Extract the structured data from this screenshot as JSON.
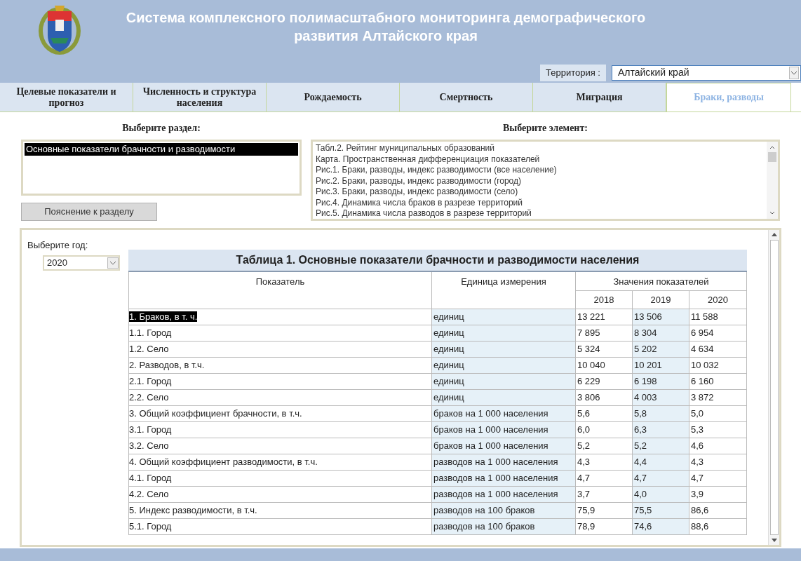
{
  "header": {
    "title": "Система комплексного полимасштабного мониторинга демографического развития Алтайского края",
    "territory": {
      "label": "Территория :",
      "value": "Алтайский край"
    }
  },
  "tabs": [
    {
      "label": "Целевые показатели и прогноз",
      "selected": false
    },
    {
      "label": "Численность и структура населения",
      "selected": false
    },
    {
      "label": "Рождаемость",
      "selected": false
    },
    {
      "label": "Смертность",
      "selected": false
    },
    {
      "label": "Миграция",
      "selected": false
    },
    {
      "label": "Браки, разводы",
      "selected": true
    }
  ],
  "sections": {
    "heading": "Выберите раздел:",
    "items": [
      {
        "label": "Основные показатели брачности и разводимости",
        "selected": true
      }
    ],
    "button": "Пояснение к разделу"
  },
  "elements": {
    "heading": "Выберите элемент:",
    "items": [
      {
        "label": "Табл.2. Рейтинг муниципальных образований",
        "selected": false
      },
      {
        "label": "Карта. Пространственная дифференциация показателей",
        "selected": false
      },
      {
        "label": "Рис.1. Браки, разводы, индекс разводимости (все население)",
        "selected": false
      },
      {
        "label": "Рис.2. Браки, разводы, индекс разводимости (город)",
        "selected": false
      },
      {
        "label": "Рис.3. Браки, разводы, индекс разводимости (село)",
        "selected": false
      },
      {
        "label": "Рис.4. Динамика числа браков в разрезе территорий",
        "selected": false
      },
      {
        "label": "Рис.5. Динамика числа разводов в разрезе территорий",
        "selected": false
      }
    ]
  },
  "year": {
    "label": "Выберите год:",
    "value": "2020"
  },
  "table": {
    "title": "Таблица 1. Основные показатели брачности и разводимости населения",
    "columns": {
      "indicator": "Показатель",
      "unit": "Единица измерения",
      "values": "Значения показателей",
      "years": [
        "2018",
        "2019",
        "2020"
      ]
    },
    "rows": [
      {
        "indicator": "1. Браков, в т. ч.",
        "unit": "единиц",
        "values": [
          "13 221",
          "13 506",
          "11 588"
        ],
        "selected": true
      },
      {
        "indicator": "1.1. Город",
        "unit": "единиц",
        "values": [
          "7 895",
          "8 304",
          "6 954"
        ],
        "selected": false
      },
      {
        "indicator": "1.2. Село",
        "unit": "единиц",
        "values": [
          "5 324",
          "5 202",
          "4 634"
        ],
        "selected": false
      },
      {
        "indicator": "2. Разводов, в т.ч.",
        "unit": "единиц",
        "values": [
          "10 040",
          "10 201",
          "10 032"
        ],
        "selected": false
      },
      {
        "indicator": "2.1. Город",
        "unit": "единиц",
        "values": [
          "6 229",
          "6 198",
          "6 160"
        ],
        "selected": false
      },
      {
        "indicator": "2.2. Село",
        "unit": "единиц",
        "values": [
          "3 806",
          "4 003",
          "3 872"
        ],
        "selected": false
      },
      {
        "indicator": "3. Общий коэффициент брачности, в т.ч.",
        "unit": "браков на 1 000 населения",
        "values": [
          "5,6",
          "5,8",
          "5,0"
        ],
        "selected": false
      },
      {
        "indicator": "3.1. Город",
        "unit": "браков на 1 000 населения",
        "values": [
          "6,0",
          "6,3",
          "5,3"
        ],
        "selected": false
      },
      {
        "indicator": "3.2. Село",
        "unit": "браков на 1 000 населения",
        "values": [
          "5,2",
          "5,2",
          "4,6"
        ],
        "selected": false
      },
      {
        "indicator": "4. Общий коэффициент разводимости, в т.ч.",
        "unit": "разводов на 1 000 населения",
        "values": [
          "4,3",
          "4,4",
          "4,3"
        ],
        "selected": false
      },
      {
        "indicator": "4.1. Город",
        "unit": "разводов на 1 000 населения",
        "values": [
          "4,7",
          "4,7",
          "4,7"
        ],
        "selected": false
      },
      {
        "indicator": "4.2. Село",
        "unit": "разводов на 1 000 населения",
        "values": [
          "3,7",
          "4,0",
          "3,9"
        ],
        "selected": false
      },
      {
        "indicator": "5. Индекс разводимости, в т.ч.",
        "unit": "разводов на 100 браков",
        "values": [
          "75,9",
          "75,5",
          "86,6"
        ],
        "selected": false
      },
      {
        "indicator": "5.1. Город",
        "unit": "разводов на 100 браков",
        "values": [
          "78,9",
          "74,6",
          "88,6"
        ],
        "selected": false
      }
    ]
  }
}
